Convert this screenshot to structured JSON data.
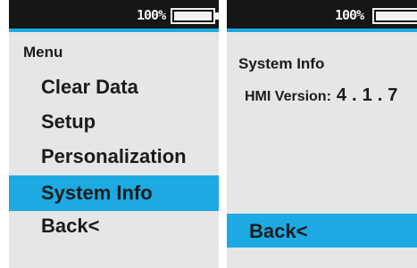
{
  "colors": {
    "accent": "#1da9e1",
    "status_bar": "#161616",
    "screen_background": "#e6e6e6",
    "text": "#1b1b1b"
  },
  "left_screen": {
    "status": {
      "battery_text": "100%",
      "battery_level": 1.0
    },
    "heading": "Menu",
    "menu_items": [
      {
        "label": "Clear Data",
        "selected": false
      },
      {
        "label": "Setup",
        "selected": false
      },
      {
        "label": "Personalization",
        "selected": false
      },
      {
        "label": "System Info",
        "selected": true
      },
      {
        "label": "Back<",
        "selected": false
      }
    ]
  },
  "right_screen": {
    "status": {
      "battery_text": "100%",
      "battery_level": 1.0
    },
    "heading": "System Info",
    "version_label": "HMI Version:",
    "version_value": "4.1.7",
    "back_label": "Back<"
  },
  "icons": [
    "battery-icon"
  ]
}
